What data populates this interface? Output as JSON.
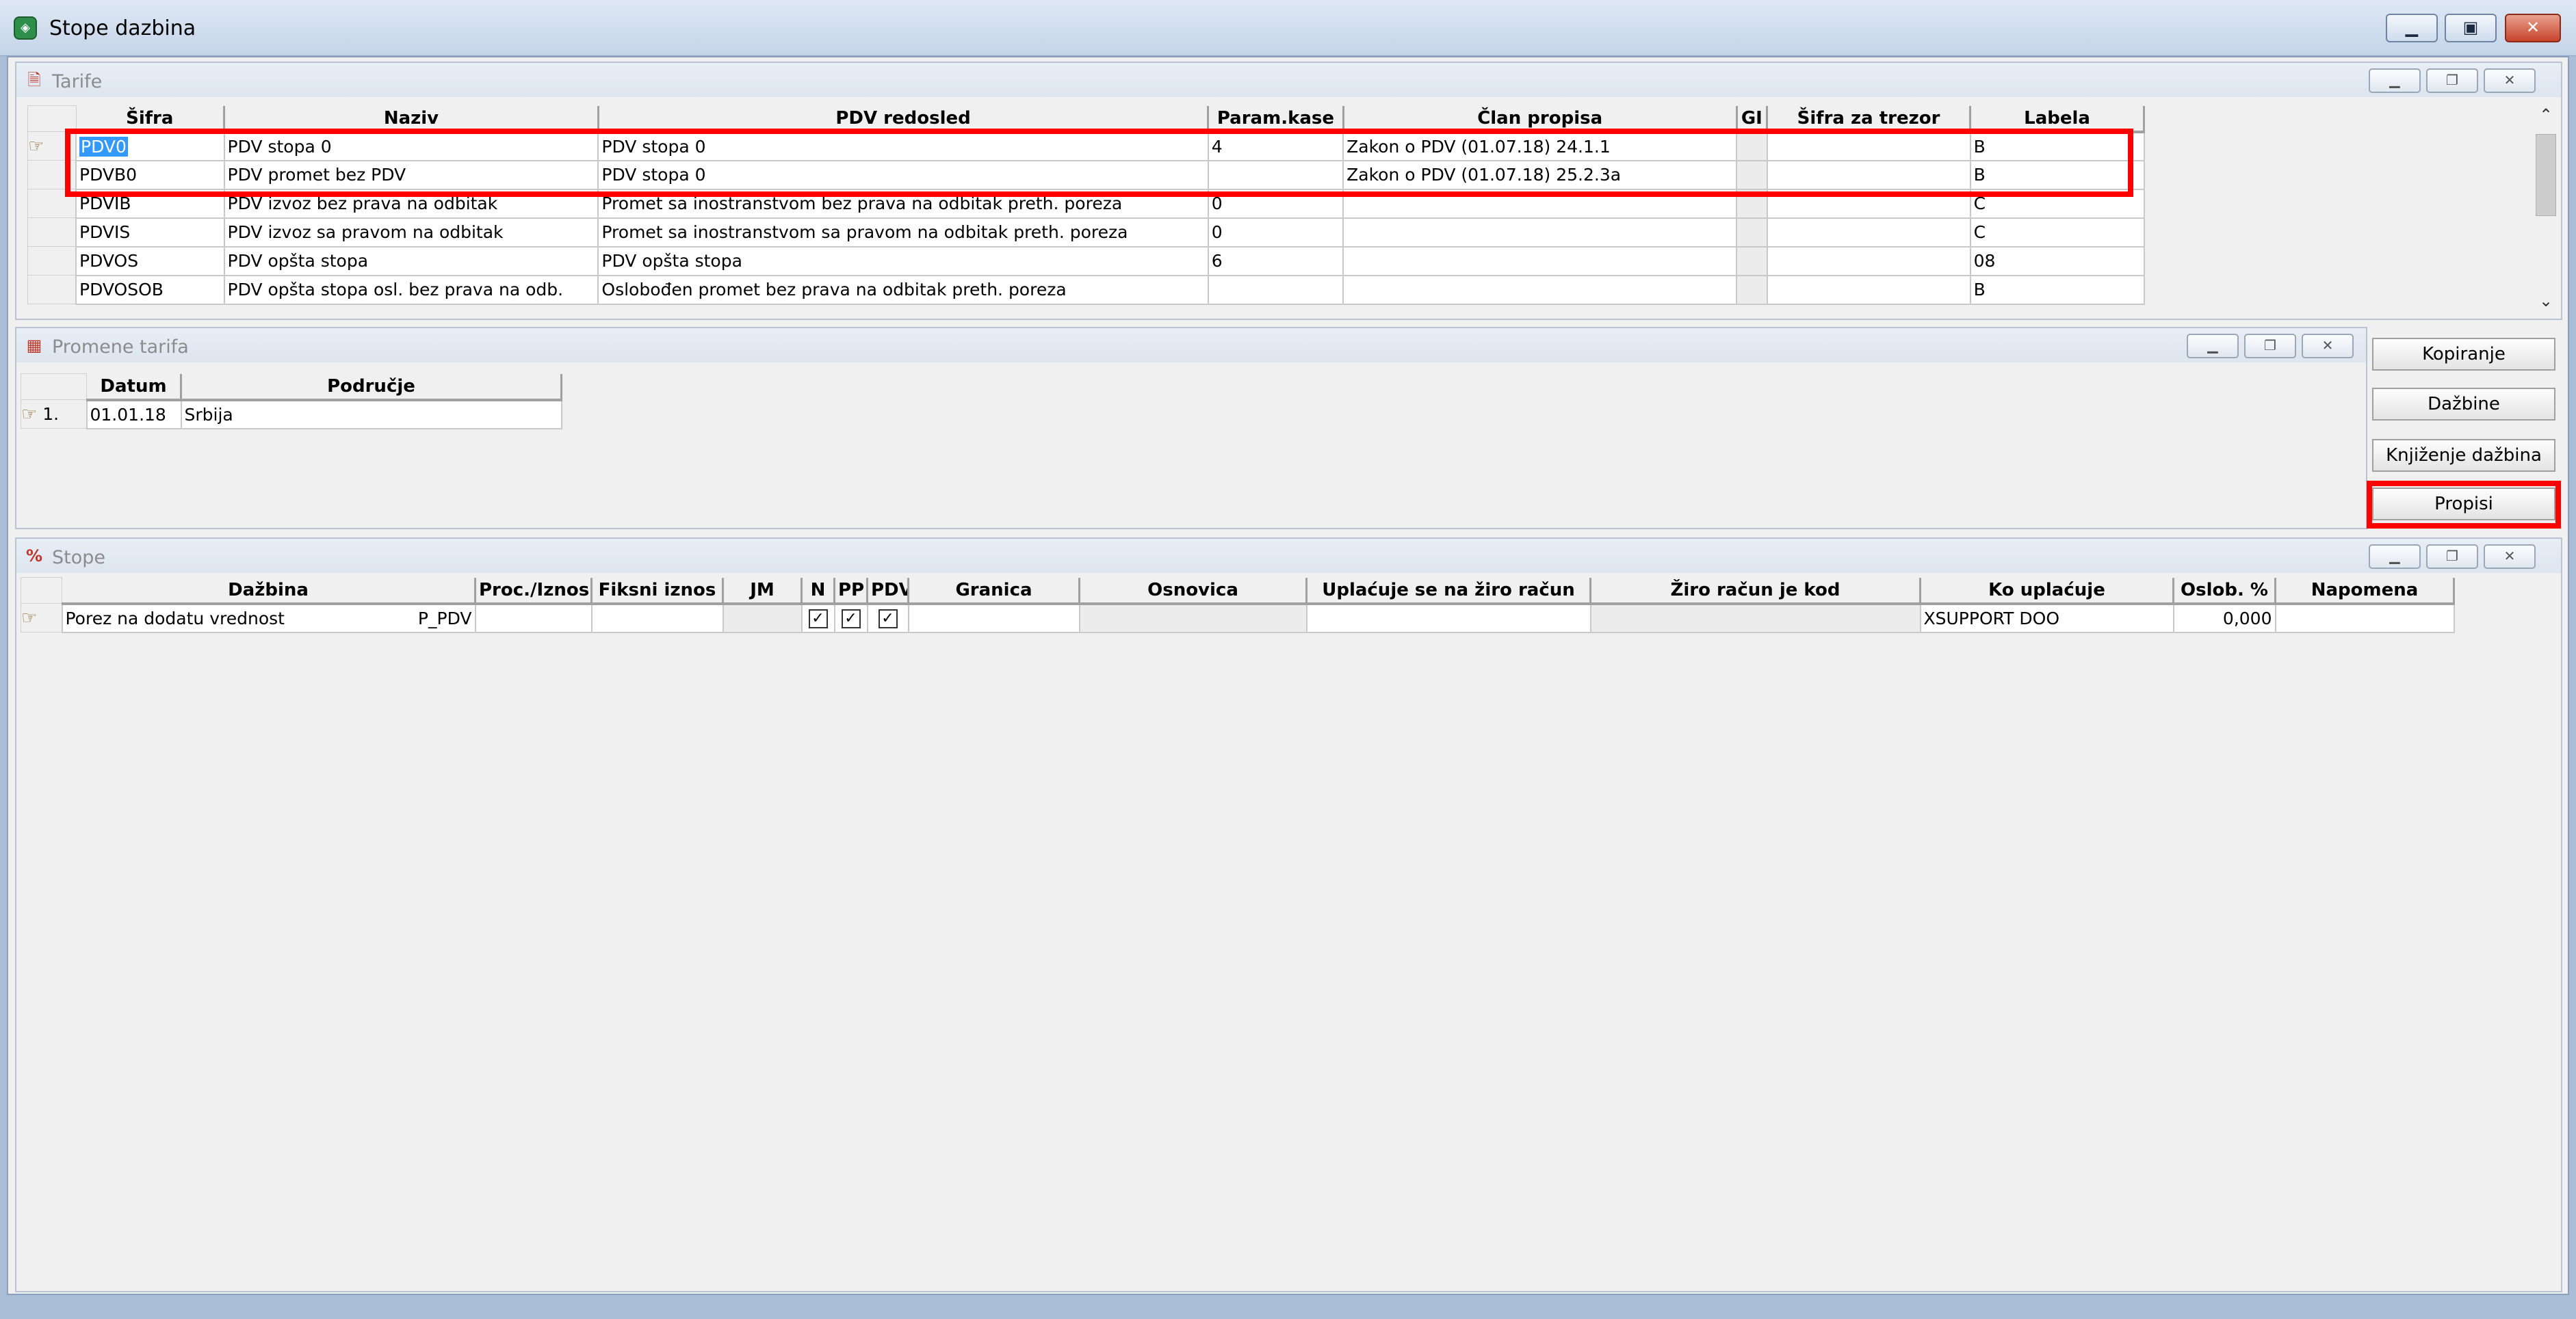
{
  "window": {
    "title": "Stope dazbina",
    "icon": "app-logo-icon"
  },
  "tarife": {
    "title": "Tarife",
    "columns": [
      "Šifra",
      "Naziv",
      "PDV redosled",
      "Param.kase",
      "Član propisa",
      "GI",
      "Šifra za trezor",
      "Labela"
    ],
    "rows": [
      [
        "PDV0",
        "PDV stopa 0",
        "PDV stopa 0",
        "4",
        "Zakon o PDV (01.07.18) 24.1.1",
        "",
        "",
        "B"
      ],
      [
        "PDVB0",
        "PDV promet bez PDV",
        "PDV stopa 0",
        "",
        "Zakon o PDV (01.07.18) 25.2.3a",
        "",
        "",
        "B"
      ],
      [
        "PDVIB",
        "PDV izvoz bez prava na odbitak",
        "Promet sa inostranstvom bez prava na odbitak preth. poreza",
        "0",
        "",
        "",
        "",
        "C"
      ],
      [
        "PDVIS",
        "PDV izvoz sa pravom na odbitak",
        "Promet sa inostranstvom sa pravom na odbitak preth. poreza",
        "0",
        "",
        "",
        "",
        "C"
      ],
      [
        "PDVOS",
        "PDV opšta stopa",
        "PDV opšta stopa",
        "6",
        "",
        "",
        "",
        "08"
      ],
      [
        "PDVOSOB",
        "PDV opšta stopa osl. bez prava na odb.",
        "Oslobođen promet bez prava na odbitak preth. poreza",
        "",
        "",
        "",
        "",
        "B"
      ]
    ]
  },
  "promene": {
    "title": "Promene tarifa",
    "columns": [
      "Datum",
      "Područje"
    ],
    "rows": [
      {
        "num": "1.",
        "datum": "01.01.18",
        "podrucje": "Srbija"
      }
    ]
  },
  "buttons": {
    "kopiranje": "Kopiranje",
    "dazbine": "Dažbine",
    "knjizenje": "Knjiženje dažbina",
    "propisi": "Propisi"
  },
  "stope": {
    "title": "Stope",
    "columns": [
      "Dažbina",
      "Proc./Iznos",
      "Fiksni iznos",
      "JM",
      "N",
      "PP",
      "PDV",
      "Granica",
      "Osnovica",
      "Uplaćuje se na žiro račun",
      "Žiro račun je kod",
      "Ko uplaćuje",
      "Oslob. %",
      "Napomena"
    ],
    "row": {
      "dazbina": "Porez na dodatu vrednost",
      "code": "P_PDV",
      "n": true,
      "pp": true,
      "pdv": true,
      "ko_uplacuje": "XSUPPORT DOO",
      "oslob": "0,000"
    }
  },
  "colors": {
    "highlight": "#ff0000",
    "selection": "#3399ff"
  }
}
